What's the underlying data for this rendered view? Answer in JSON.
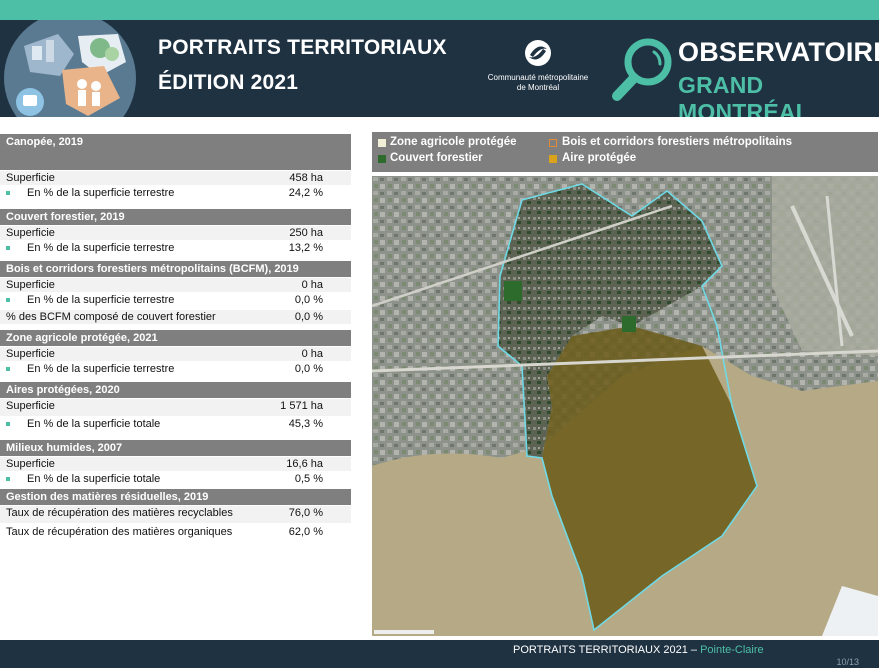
{
  "header": {
    "title_line1": "PORTRAITS TERRITORIAUX",
    "title_line2": "ÉDITION 2021",
    "cmm_line1": "Communauté métropolitaine",
    "cmm_line2": "de Montréal",
    "obs_line1": "OBSERVATOIRE",
    "obs_line2": "GRAND MONTRÉAL"
  },
  "sections": [
    {
      "title": "Canopée, 2019",
      "rows": [
        {
          "label": "Superficie",
          "value": "458 ha",
          "indent": false
        },
        {
          "label": "En % de la superficie terrestre",
          "value": "24,2 %",
          "indent": true
        }
      ]
    },
    {
      "title": "Couvert forestier, 2019",
      "rows": [
        {
          "label": "Superficie",
          "value": "250 ha",
          "indent": false
        },
        {
          "label": "En % de la superficie terrestre",
          "value": "13,2 %",
          "indent": true
        }
      ]
    },
    {
      "title": "Bois et corridors forestiers métropolitains (BCFM), 2019",
      "rows": [
        {
          "label": "Superficie",
          "value": "0 ha",
          "indent": false
        },
        {
          "label": "En % de la superficie terrestre",
          "value": "0,0 %",
          "indent": true
        },
        {
          "label": "% des BCFM composé de couvert forestier",
          "value": "0,0 %",
          "indent": false
        }
      ]
    },
    {
      "title": "Zone agricole protégée, 2021",
      "rows": [
        {
          "label": "Superficie",
          "value": "0 ha",
          "indent": false
        },
        {
          "label": "En % de la superficie terrestre",
          "value": "0,0 %",
          "indent": true
        }
      ]
    },
    {
      "title": "Aires protégées, 2020",
      "rows": [
        {
          "label": "Superficie",
          "value": "1 571 ha",
          "indent": false
        },
        {
          "label": "En % de la superficie totale",
          "value": "45,3 %",
          "indent": true
        }
      ]
    },
    {
      "title": "Milieux humides, 2007",
      "rows": [
        {
          "label": "Superficie",
          "value": "16,6 ha",
          "indent": false
        },
        {
          "label": "En % de la superficie totale",
          "value": "0,5 %",
          "indent": true
        }
      ]
    },
    {
      "title": "Gestion des matières résiduelles, 2019",
      "rows": [
        {
          "label": "Taux de récupération des matières recyclables",
          "value": "76,0 %",
          "indent": false
        },
        {
          "label": "Taux de récupération des matières organiques",
          "value": "62,0 %",
          "indent": false
        }
      ]
    }
  ],
  "legend": {
    "zone_agricole": "Zone agricole protégée",
    "bois_corridors": "Bois et corridors forestiers métropolitains",
    "couvert": "Couvert forestier",
    "aire": "Aire protégée"
  },
  "colors": {
    "navy": "#1f3242",
    "teal": "#4dbfa6",
    "zone_agricole": "#f1efd6",
    "bois_corridors": "#e08a3c",
    "couvert": "#2d6b2d",
    "aire": "#d9a31c"
  },
  "footer": {
    "text": "PORTRAITS TERRITORIAUX 2021 – ",
    "city": "Pointe-Claire",
    "page": "10/13"
  }
}
